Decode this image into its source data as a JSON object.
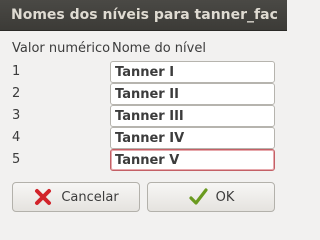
{
  "window": {
    "title": "Nomes dos níveis para tanner_fac"
  },
  "table": {
    "header_value": "Valor numérico",
    "header_name": "Nome do nível",
    "rows": [
      {
        "number": "1",
        "name": "Tanner I"
      },
      {
        "number": "2",
        "name": "Tanner II"
      },
      {
        "number": "3",
        "name": "Tanner III"
      },
      {
        "number": "4",
        "name": "Tanner IV"
      },
      {
        "number": "5",
        "name": "Tanner V"
      }
    ]
  },
  "buttons": {
    "cancel_label": "Cancelar",
    "cancel_icon": "cancel-x-icon",
    "ok_label": "OK",
    "ok_icon": "checkmark-icon"
  },
  "colors": {
    "titlebar": "#3c3b37",
    "title_text": "#dfdbd2",
    "focus_border": "#c46066",
    "cancel_icon": "#d2232a",
    "ok_icon": "#6a9a1f"
  }
}
